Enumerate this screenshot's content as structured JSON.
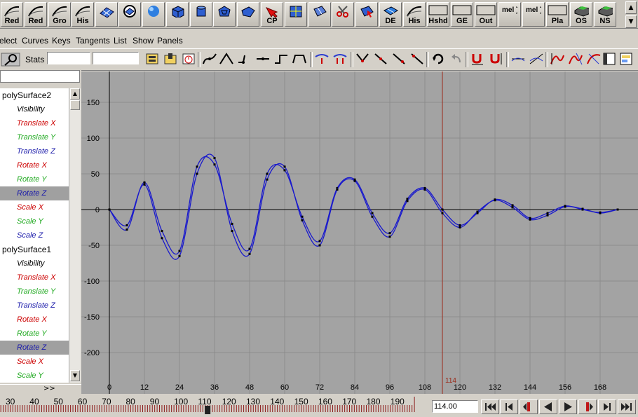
{
  "shelf": {
    "buttons": [
      {
        "label": "Red",
        "icon": "curve-icon"
      },
      {
        "label": "Red",
        "icon": "curve-icon"
      },
      {
        "label": "Gro",
        "icon": "curve-icon"
      },
      {
        "label": "His",
        "icon": "curve-icon"
      },
      {
        "label": "",
        "icon": "plane-grid-icon"
      },
      {
        "label": "",
        "icon": "circle-grid-icon"
      },
      {
        "label": "",
        "icon": "sphere-icon"
      },
      {
        "label": "",
        "icon": "cube-icon"
      },
      {
        "label": "",
        "icon": "cylinder-icon"
      },
      {
        "label": "",
        "icon": "polyhedron-icon"
      },
      {
        "label": "",
        "icon": "prism-icon"
      },
      {
        "label": "CP",
        "icon": "red-arrow-icon"
      },
      {
        "label": "",
        "icon": "grid-face-icon"
      },
      {
        "label": "",
        "icon": "textured-plane-icon"
      },
      {
        "label": "",
        "icon": "scissors-icon"
      },
      {
        "label": "",
        "icon": "select-face-icon"
      },
      {
        "label": "DE",
        "icon": "blue-face-icon"
      },
      {
        "label": "His",
        "icon": "curve-icon"
      },
      {
        "label": "Hshd",
        "icon": "blank-box-icon"
      },
      {
        "label": "GE",
        "icon": "blank-box-icon"
      },
      {
        "label": "Out",
        "icon": "blank-box-icon"
      },
      {
        "label": "",
        "icon": "mel-script-icon"
      },
      {
        "label": "",
        "icon": "mel-script-icon"
      },
      {
        "label": "Pla",
        "icon": "blank-box-icon"
      },
      {
        "label": "OS",
        "icon": "dark-box-icon"
      },
      {
        "label": "NS",
        "icon": "dark-box-icon"
      }
    ],
    "mel_label": "mel"
  },
  "menu": {
    "items": [
      "elect",
      "Curves",
      "Keys",
      "Tangents",
      "List",
      "Show",
      "Panels"
    ]
  },
  "toolbar": {
    "stats_label": "Stats",
    "stats_value1": "",
    "stats_value2": ""
  },
  "outliner": {
    "expand_label": ">>",
    "rows": [
      {
        "text": "polySurface2",
        "kind": "obj",
        "color": "#000000",
        "selected": false
      },
      {
        "text": "Visibility",
        "kind": "attr",
        "color": "#000000",
        "selected": false
      },
      {
        "text": "Translate X",
        "kind": "attr",
        "color": "#cc0000",
        "selected": false
      },
      {
        "text": "Translate Y",
        "kind": "attr",
        "color": "#22aa22",
        "selected": false
      },
      {
        "text": "Translate Z",
        "kind": "attr",
        "color": "#1a1aaa",
        "selected": false
      },
      {
        "text": "Rotate X",
        "kind": "attr",
        "color": "#cc0000",
        "selected": false
      },
      {
        "text": "Rotate Y",
        "kind": "attr",
        "color": "#22aa22",
        "selected": false
      },
      {
        "text": "Rotate Z",
        "kind": "attr",
        "color": "#1a1aaa",
        "selected": true
      },
      {
        "text": "Scale X",
        "kind": "attr",
        "color": "#cc0000",
        "selected": false
      },
      {
        "text": "Scale Y",
        "kind": "attr",
        "color": "#22aa22",
        "selected": false
      },
      {
        "text": "Scale Z",
        "kind": "attr",
        "color": "#1a1aaa",
        "selected": false
      },
      {
        "text": "polySurface1",
        "kind": "obj",
        "color": "#000000",
        "selected": false
      },
      {
        "text": "Visibility",
        "kind": "attr",
        "color": "#000000",
        "selected": false
      },
      {
        "text": "Translate X",
        "kind": "attr",
        "color": "#cc0000",
        "selected": false
      },
      {
        "text": "Translate Y",
        "kind": "attr",
        "color": "#22aa22",
        "selected": false
      },
      {
        "text": "Translate Z",
        "kind": "attr",
        "color": "#1a1aaa",
        "selected": false
      },
      {
        "text": "Rotate X",
        "kind": "attr",
        "color": "#cc0000",
        "selected": false
      },
      {
        "text": "Rotate Y",
        "kind": "attr",
        "color": "#22aa22",
        "selected": false
      },
      {
        "text": "Rotate Z",
        "kind": "attr",
        "color": "#1a1aaa",
        "selected": true
      },
      {
        "text": "Scale X",
        "kind": "attr",
        "color": "#cc0000",
        "selected": false
      },
      {
        "text": "Scale Y",
        "kind": "attr",
        "color": "#22aa22",
        "selected": false
      }
    ]
  },
  "graph": {
    "current_frame_label": "114",
    "current_frame": 114,
    "background": "#a3a3a3",
    "curve_color": "#1a1acc",
    "time_marker_color": "#9b2a1a"
  },
  "chart_data": {
    "type": "line",
    "xlim": [
      -4,
      178
    ],
    "ylim": [
      -240,
      170
    ],
    "x_ticks": [
      0,
      12,
      24,
      36,
      48,
      60,
      72,
      84,
      96,
      108,
      120,
      132,
      144,
      156,
      168
    ],
    "y_ticks": [
      150,
      100,
      50,
      0,
      -50,
      -100,
      -150,
      -200
    ],
    "series": [
      {
        "x": [
          0,
          6,
          12,
          18,
          24,
          30,
          36,
          42,
          48,
          54,
          60,
          66,
          72,
          78,
          84,
          90,
          96,
          102,
          108,
          114,
          120,
          126,
          132,
          138,
          144,
          150,
          156,
          162,
          168,
          174
        ],
        "y": [
          0,
          -28,
          38,
          -30,
          -58,
          60,
          63,
          -20,
          -55,
          50,
          55,
          -10,
          -44,
          30,
          42,
          -5,
          -33,
          15,
          30,
          0,
          -22,
          -5,
          14,
          6,
          -12,
          -5,
          5,
          0,
          -4,
          0
        ]
      },
      {
        "x": [
          0,
          6,
          12,
          18,
          24,
          30,
          36,
          42,
          48,
          54,
          60,
          66,
          72,
          78,
          84,
          90,
          96,
          102,
          108,
          114,
          120,
          126,
          132,
          138,
          144,
          150,
          156,
          162,
          168,
          174
        ],
        "y": [
          0,
          -22,
          35,
          -40,
          -65,
          50,
          72,
          -30,
          -62,
          42,
          60,
          -15,
          -50,
          28,
          40,
          -10,
          -38,
          12,
          28,
          -5,
          -25,
          -3,
          13,
          3,
          -14,
          -8,
          4,
          1,
          -5,
          0
        ]
      }
    ]
  },
  "timeslider": {
    "tick_labels": [
      "30",
      "40",
      "50",
      "60",
      "70",
      "80",
      "90",
      "100",
      "110",
      "120",
      "130",
      "140",
      "150",
      "160",
      "170",
      "180",
      "190"
    ],
    "current_time": "114.00"
  },
  "playback": {
    "buttons": [
      "go-to-start-icon",
      "step-back-icon",
      "step-back-key-icon",
      "play-backward-icon",
      "play-forward-icon",
      "step-forward-key-icon",
      "step-forward-icon",
      "go-to-end-icon"
    ]
  }
}
